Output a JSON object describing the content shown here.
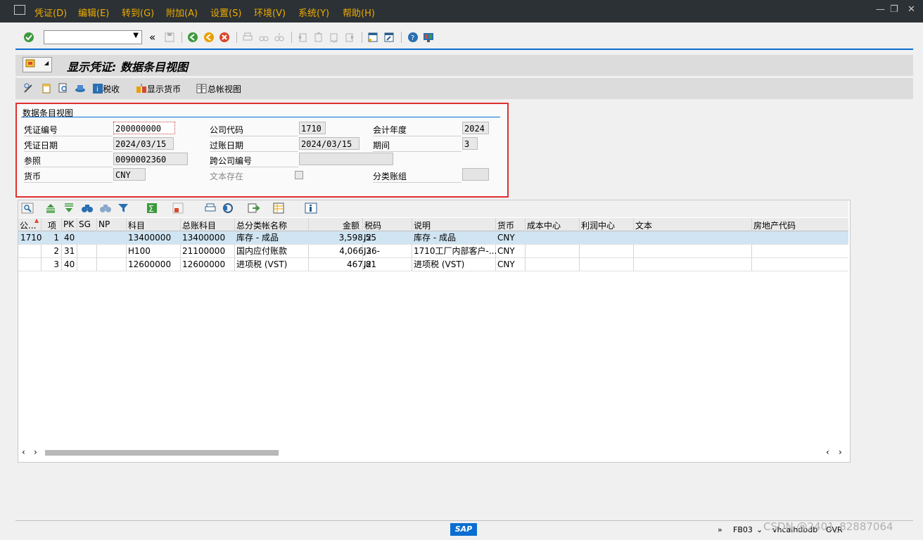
{
  "menu": {
    "items": [
      "凭证(D)",
      "编辑(E)",
      "转到(G)",
      "附加(A)",
      "设置(S)",
      "环境(V)",
      "系统(Y)",
      "帮助(H)"
    ],
    "window_buttons": [
      "—",
      "❐",
      "✕"
    ]
  },
  "toolbar": {
    "nav_back_label": "«",
    "command_value": ""
  },
  "title": {
    "text": "显示凭证: 数据条目视图"
  },
  "app_toolbar": {
    "tax_label": "税收",
    "display_currency_label": "显示货币",
    "gl_view_label": "总帐视图"
  },
  "header": {
    "group_title": "数据条目视图",
    "fields": {
      "doc_no_label": "凭证编号",
      "doc_no_value": "200000000",
      "company_code_label": "公司代码",
      "company_code_value": "1710",
      "fiscal_year_label": "会计年度",
      "fiscal_year_value": "2024",
      "doc_date_label": "凭证日期",
      "doc_date_value": "2024/03/15",
      "posting_date_label": "过账日期",
      "posting_date_value": "2024/03/15",
      "period_label": "期间",
      "period_value": "3",
      "reference_label": "参照",
      "reference_value": "0090002360",
      "cross_cc_label": "跨公司编号",
      "cross_cc_value": "",
      "currency_label": "货币",
      "currency_value": "CNY",
      "text_exists_label": "文本存在",
      "ledger_group_label": "分类账组",
      "ledger_group_value": ""
    }
  },
  "grid": {
    "columns": [
      "公...",
      "项",
      "PK",
      "SG",
      "NP",
      "科目",
      "总账科目",
      "总分类帐名称",
      "金额",
      "税码",
      "说明",
      "货币",
      "成本中心",
      "利润中心",
      "文本",
      "房地产代码"
    ],
    "rows": [
      {
        "cc": "1710",
        "item": "1",
        "pk": "40",
        "sg": "",
        "np": "",
        "account": "13400000",
        "gl": "13400000",
        "gl_name": "库存 - 成品",
        "amount": "3,598.55",
        "tax": "J2",
        "desc": "库存 - 成品",
        "curr": "CNY"
      },
      {
        "cc": "",
        "item": "2",
        "pk": "31",
        "sg": "",
        "np": "",
        "account": "H100",
        "gl": "21100000",
        "gl_name": "国内应付账款",
        "amount": "4,066.36-",
        "tax": "J2",
        "desc": "1710工厂内部客户-...",
        "curr": "CNY"
      },
      {
        "cc": "",
        "item": "3",
        "pk": "40",
        "sg": "",
        "np": "",
        "account": "12600000",
        "gl": "12600000",
        "gl_name": "进项税 (VST)",
        "amount": "467.81",
        "tax": "J2",
        "desc": "进项税 (VST)",
        "curr": "CNY"
      }
    ]
  },
  "status": {
    "logo": "SAP",
    "expand": "»",
    "transaction": "FB03",
    "server": "vhcalhdbdb",
    "mode": "OVR",
    "watermark": "CSDN @2401_82887064"
  },
  "colors": {
    "menubar_bg": "#2b3135",
    "menu_text": "#f0ab00",
    "accent_blue": "#0a6ed1",
    "highlight_red": "#e03030",
    "selected_row": "#d0e4f2"
  }
}
